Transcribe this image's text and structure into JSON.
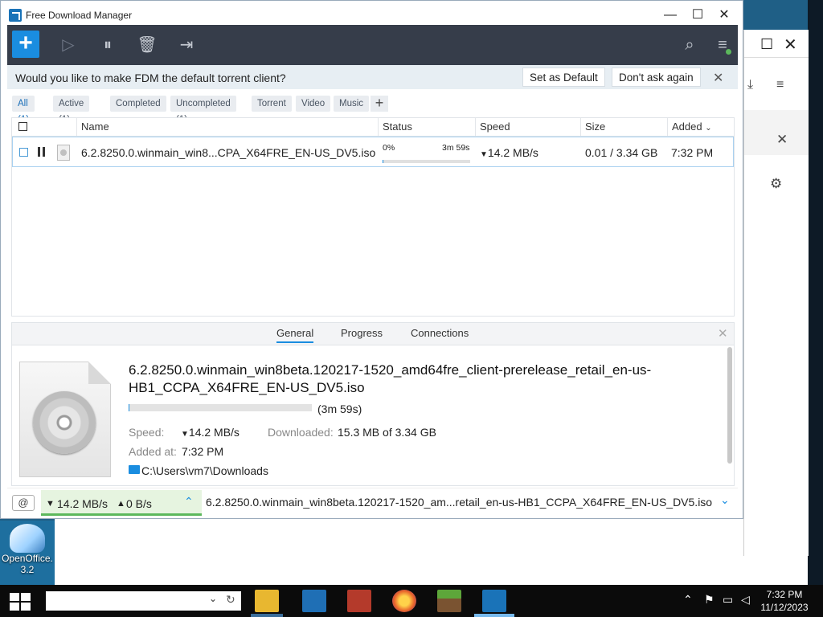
{
  "window": {
    "title": "Free Download Manager"
  },
  "notification": {
    "text": "Would you like to make FDM the default torrent client?",
    "set_default_label": "Set as Default",
    "dont_ask_label": "Don't ask again"
  },
  "filters": [
    {
      "label": "All (1)",
      "selected": true
    },
    {
      "label": "Active (1)",
      "selected": false
    },
    {
      "label": "Completed",
      "selected": false
    },
    {
      "label": "Uncompleted (1)",
      "selected": false
    },
    {
      "label": "Torrent",
      "selected": false
    },
    {
      "label": "Video",
      "selected": false
    },
    {
      "label": "Music",
      "selected": false
    }
  ],
  "table": {
    "columns": [
      "Name",
      "Status",
      "Speed",
      "Size",
      "Added"
    ],
    "rows": [
      {
        "name": "6.2.8250.0.winmain_win8...CPA_X64FRE_EN-US_DV5.iso",
        "status_percent": "0%",
        "status_eta": "3m 59s",
        "speed": "14.2 MB/s",
        "size": "0.01 / 3.34 GB",
        "added": "7:32 PM",
        "progress": 0.003
      }
    ]
  },
  "details": {
    "tabs": [
      "General",
      "Progress",
      "Connections"
    ],
    "file_name": "6.2.8250.0.winmain_win8beta.120217-1520_amd64fre_client-prerelease_retail_en-us-HB1_CCPA_X64FRE_EN-US_DV5.iso",
    "eta": "(3m 59s)",
    "speed_label": "Speed:",
    "speed_value": "14.2 MB/s",
    "downloaded_label": "Downloaded:",
    "downloaded_value": "15.3 MB of 3.34 GB",
    "added_label": "Added at:",
    "added_value": "7:32 PM",
    "folder": "C:\\Users\\vm7\\Downloads"
  },
  "statusbar": {
    "down_speed": "14.2 MB/s",
    "up_speed": "0 B/s",
    "current_file": "6.2.8250.0.winmain_win8beta.120217-1520_am...retail_en-us-HB1_CCPA_X64FRE_EN-US_DV5.iso"
  },
  "desktop": {
    "icon_label_1": "OpenOffice.",
    "icon_label_2": "3.2"
  },
  "taskbar": {
    "time": "7:32 PM",
    "date": "11/12/2023"
  },
  "colors": {
    "accent": "#1a8de0",
    "toolbar": "#363d4a",
    "notif_bg": "#e7eef3",
    "speed_green": "#5cb85c"
  }
}
